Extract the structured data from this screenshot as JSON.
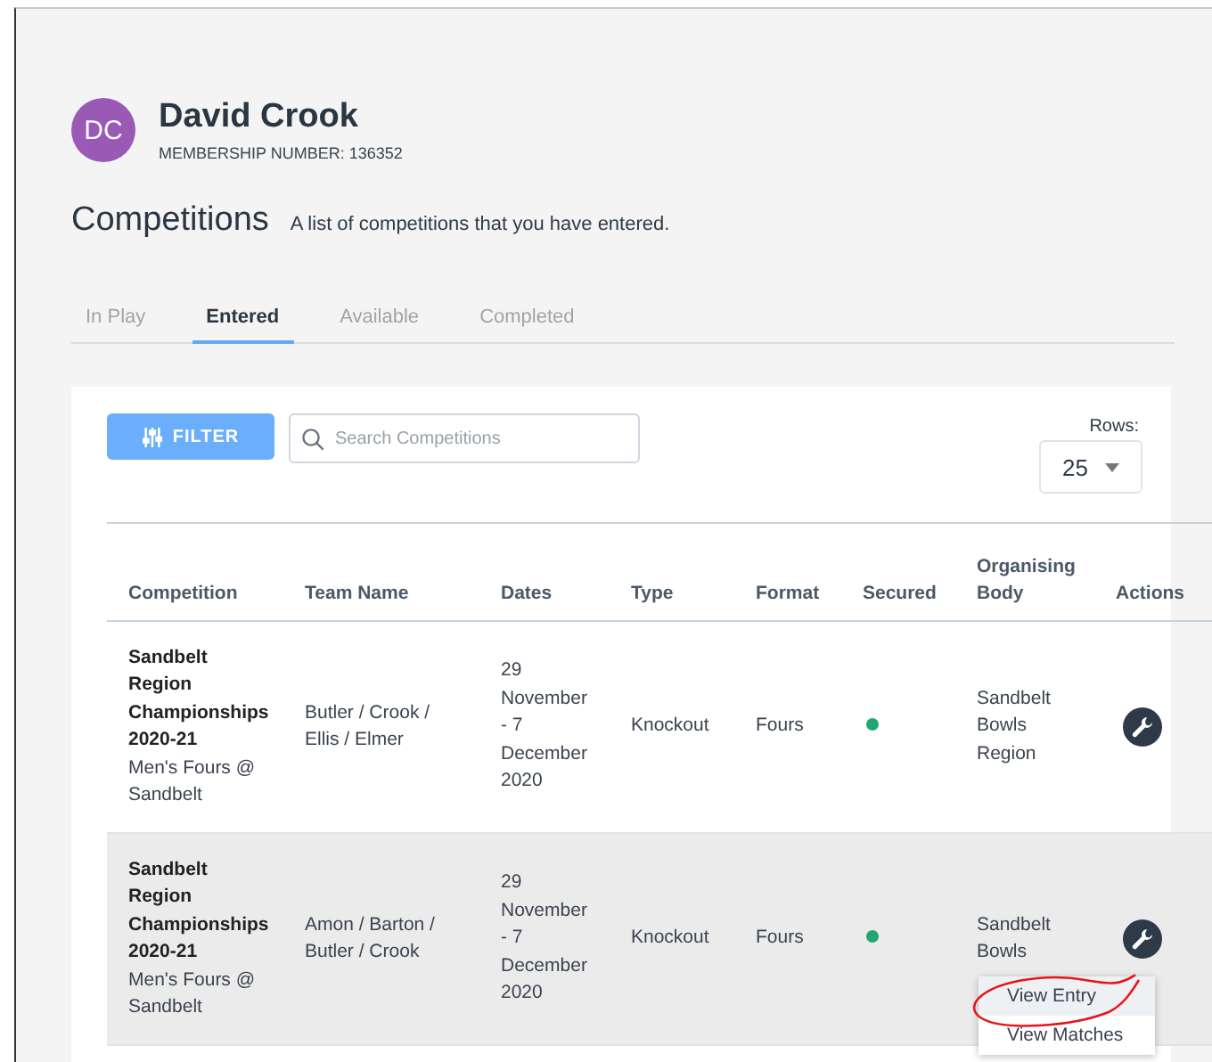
{
  "profile": {
    "initials": "DC",
    "name": "David Crook",
    "membership": "MEMBERSHIP NUMBER: 136352"
  },
  "heading": {
    "title": "Competitions",
    "subtitle": "A list of competitions that you have entered."
  },
  "tabs": [
    {
      "label": "In Play",
      "selected": false
    },
    {
      "label": "Entered",
      "selected": true
    },
    {
      "label": "Available",
      "selected": false
    },
    {
      "label": "Completed",
      "selected": false
    }
  ],
  "toolbar": {
    "filter_button": "FILTER",
    "search": {
      "placeholder": "Search Competitions"
    },
    "rows_label": "Rows:",
    "rows_value": "25"
  },
  "table": {
    "columns": [
      "Competition",
      "Team Name",
      "Dates",
      "Type",
      "Format",
      "Secured",
      "Organising Body",
      "Actions"
    ],
    "rows": [
      {
        "competition": "Sandbelt Region Championships 2020-21",
        "event": "Men's Fours @ Sandbelt",
        "team": "Butler / Crook / Ellis / Elmer",
        "dates": "29 November - 7 December 2020",
        "type": "Knockout",
        "format": "Fours",
        "secured": true,
        "body": "Sandbelt Bowls Region",
        "selected": false
      },
      {
        "competition": "Sandbelt Region Championships 2020-21",
        "event": "Men's Fours @ Sandbelt",
        "team": "Amon / Barton / Butler / Crook",
        "dates": "29 November - 7 December 2020",
        "type": "Knockout",
        "format": "Fours",
        "secured": true,
        "body": "Sandbelt Bowls",
        "selected": true
      }
    ]
  },
  "action_menu": {
    "items": [
      {
        "label": "View Entry",
        "selected": true
      },
      {
        "label": "View Matches",
        "selected": false
      }
    ]
  }
}
